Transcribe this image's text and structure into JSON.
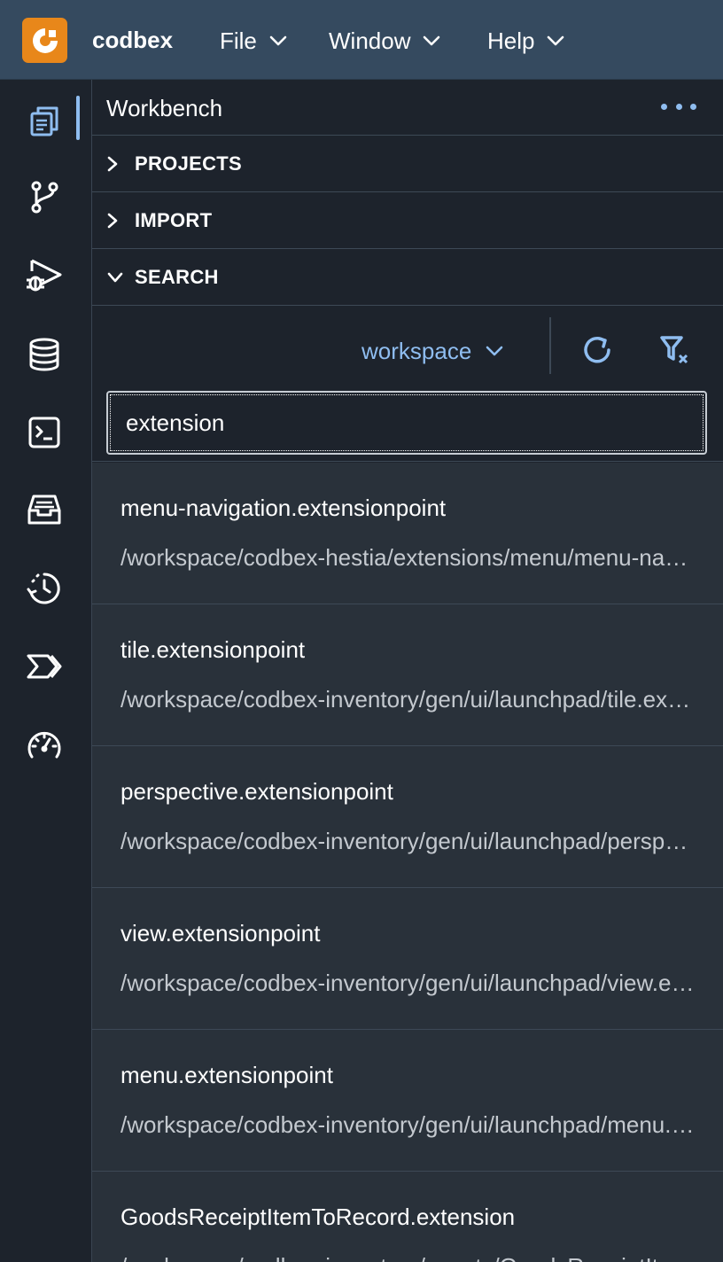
{
  "app": {
    "brand": "codbex",
    "menus": [
      {
        "label": "File"
      },
      {
        "label": "Window"
      },
      {
        "label": "Help"
      }
    ]
  },
  "activitybar": {
    "items": [
      {
        "name": "workbench-icon",
        "active": true
      },
      {
        "name": "git-branch-icon"
      },
      {
        "name": "debug-icon"
      },
      {
        "name": "database-icon"
      },
      {
        "name": "terminal-icon"
      },
      {
        "name": "inbox-icon"
      },
      {
        "name": "history-icon"
      },
      {
        "name": "process-icon"
      },
      {
        "name": "dashboard-gauge-icon"
      }
    ]
  },
  "panel": {
    "title": "Workbench",
    "sections": [
      {
        "label": "PROJECTS",
        "expanded": false
      },
      {
        "label": "IMPORT",
        "expanded": false
      },
      {
        "label": "SEARCH",
        "expanded": true
      }
    ]
  },
  "search": {
    "scope": "workspace",
    "query": "extension",
    "results": [
      {
        "name": "menu-navigation.extensionpoint",
        "path": "/workspace/codbex-hestia/extensions/menu/menu-navigation.extensionpoint"
      },
      {
        "name": "tile.extensionpoint",
        "path": "/workspace/codbex-inventory/gen/ui/launchpad/tile.extensionpoint"
      },
      {
        "name": "perspective.extensionpoint",
        "path": "/workspace/codbex-inventory/gen/ui/launchpad/perspective.extensionpoint"
      },
      {
        "name": "view.extensionpoint",
        "path": "/workspace/codbex-inventory/gen/ui/launchpad/view.extensionpoint"
      },
      {
        "name": "menu.extensionpoint",
        "path": "/workspace/codbex-inventory/gen/ui/launchpad/menu.extensionpoint"
      },
      {
        "name": "GoodsReceiptItemToRecord.extension",
        "path": "/workspace/codbex-inventory/events/GoodsReceiptItemToRecord.extension"
      }
    ]
  },
  "colors": {
    "topbar": "#354a5f",
    "accent": "#8fbdf0",
    "logo": "#e8871a",
    "background": "#1d232c",
    "results_background": "#29313a"
  }
}
